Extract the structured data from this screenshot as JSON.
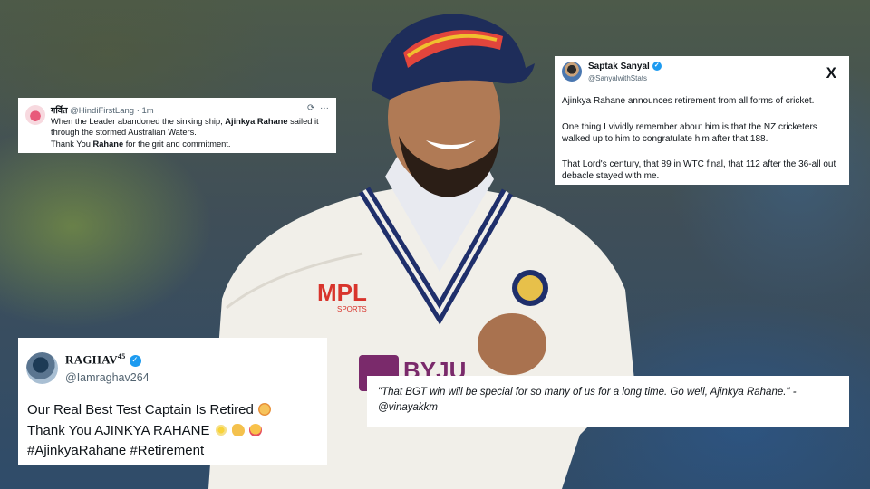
{
  "card1": {
    "name": "गर्वित",
    "handle": "@HindiFirstLang · 1m",
    "refresh_icon": "refresh-icon",
    "more_icon": "more-horizontal-icon",
    "text_a": "When the Leader abandoned the sinking ship, ",
    "text_b": "Ajinkya Rahane",
    "text_c": " sailed it",
    "line2": "through the stormed Australian Waters.",
    "line3_a": "Thank You ",
    "line3_b": "Rahane",
    "line3_c": " for the grit and commitment."
  },
  "card2": {
    "name": "Saptak Sanyal",
    "handle": "@SanyalwithStats",
    "logo": "X",
    "p1": "Ajinkya Rahane announces retirement from all forms of cricket.",
    "p2": "One thing I vividly remember about him is that the NZ cricketers walked up to him to congratulate him after that 188.",
    "p3": "That Lord's century, that 89 in WTC final, that 112 after the 36-all out debacle stayed with me."
  },
  "card3": {
    "name": "RAGHAV",
    "name_sup": "45",
    "handle": "@Iamraghav264",
    "line1": "Our Real Best Test Captain Is Retired",
    "line2": "Thank You AJINKYA RAHANE",
    "line3": "#AjinkyaRahane #Retirement"
  },
  "card4": {
    "quote": "\"That BGT win will be special for so many of us for a long time. Go well, Ajinkya Rahane.\" -",
    "attribution": "@vinayakkm"
  },
  "photo": {
    "jersey_logo": "MPL",
    "jersey_logo_sub": "SPORTS",
    "sponsor": "BYJU"
  },
  "colors": {
    "verified_blue": "#1d9bf0",
    "jersey_navy": "#1f2f6b",
    "mpl_red": "#d8342c",
    "byju_purple": "#7a2a6b"
  }
}
